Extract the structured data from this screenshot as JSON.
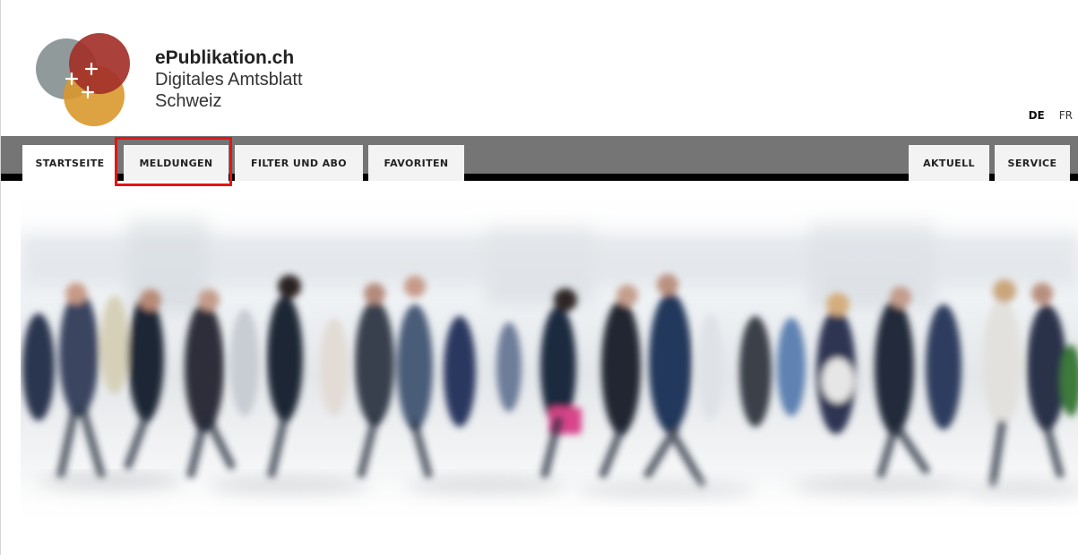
{
  "header": {
    "site_name": "ePublikation.ch",
    "subtitle_line1": "Digitales Amtsblatt",
    "subtitle_line2": "Schweiz",
    "logo_icon": "plus-circles-logo-icon"
  },
  "languages": {
    "active": "DE",
    "other": "FR"
  },
  "nav": {
    "tabs": [
      {
        "label": "STARTSEITE",
        "active": true
      },
      {
        "label": "MELDUNGEN",
        "active": false,
        "highlighted": true
      },
      {
        "label": "FILTER UND ABO",
        "active": false
      },
      {
        "label": "FAVORITEN",
        "active": false
      }
    ],
    "right_tabs": [
      {
        "label": "AKTUELL"
      },
      {
        "label": "SERVICE"
      }
    ]
  },
  "colors": {
    "nav_bar": "#757575",
    "tab_bg": "#f3f3f3",
    "highlight": "#e41414",
    "logo_gray": "#8a9596",
    "logo_red": "#a3312a",
    "logo_orange": "#d9982e"
  },
  "hero": {
    "image": "blurred-crowd-walking-photo"
  }
}
